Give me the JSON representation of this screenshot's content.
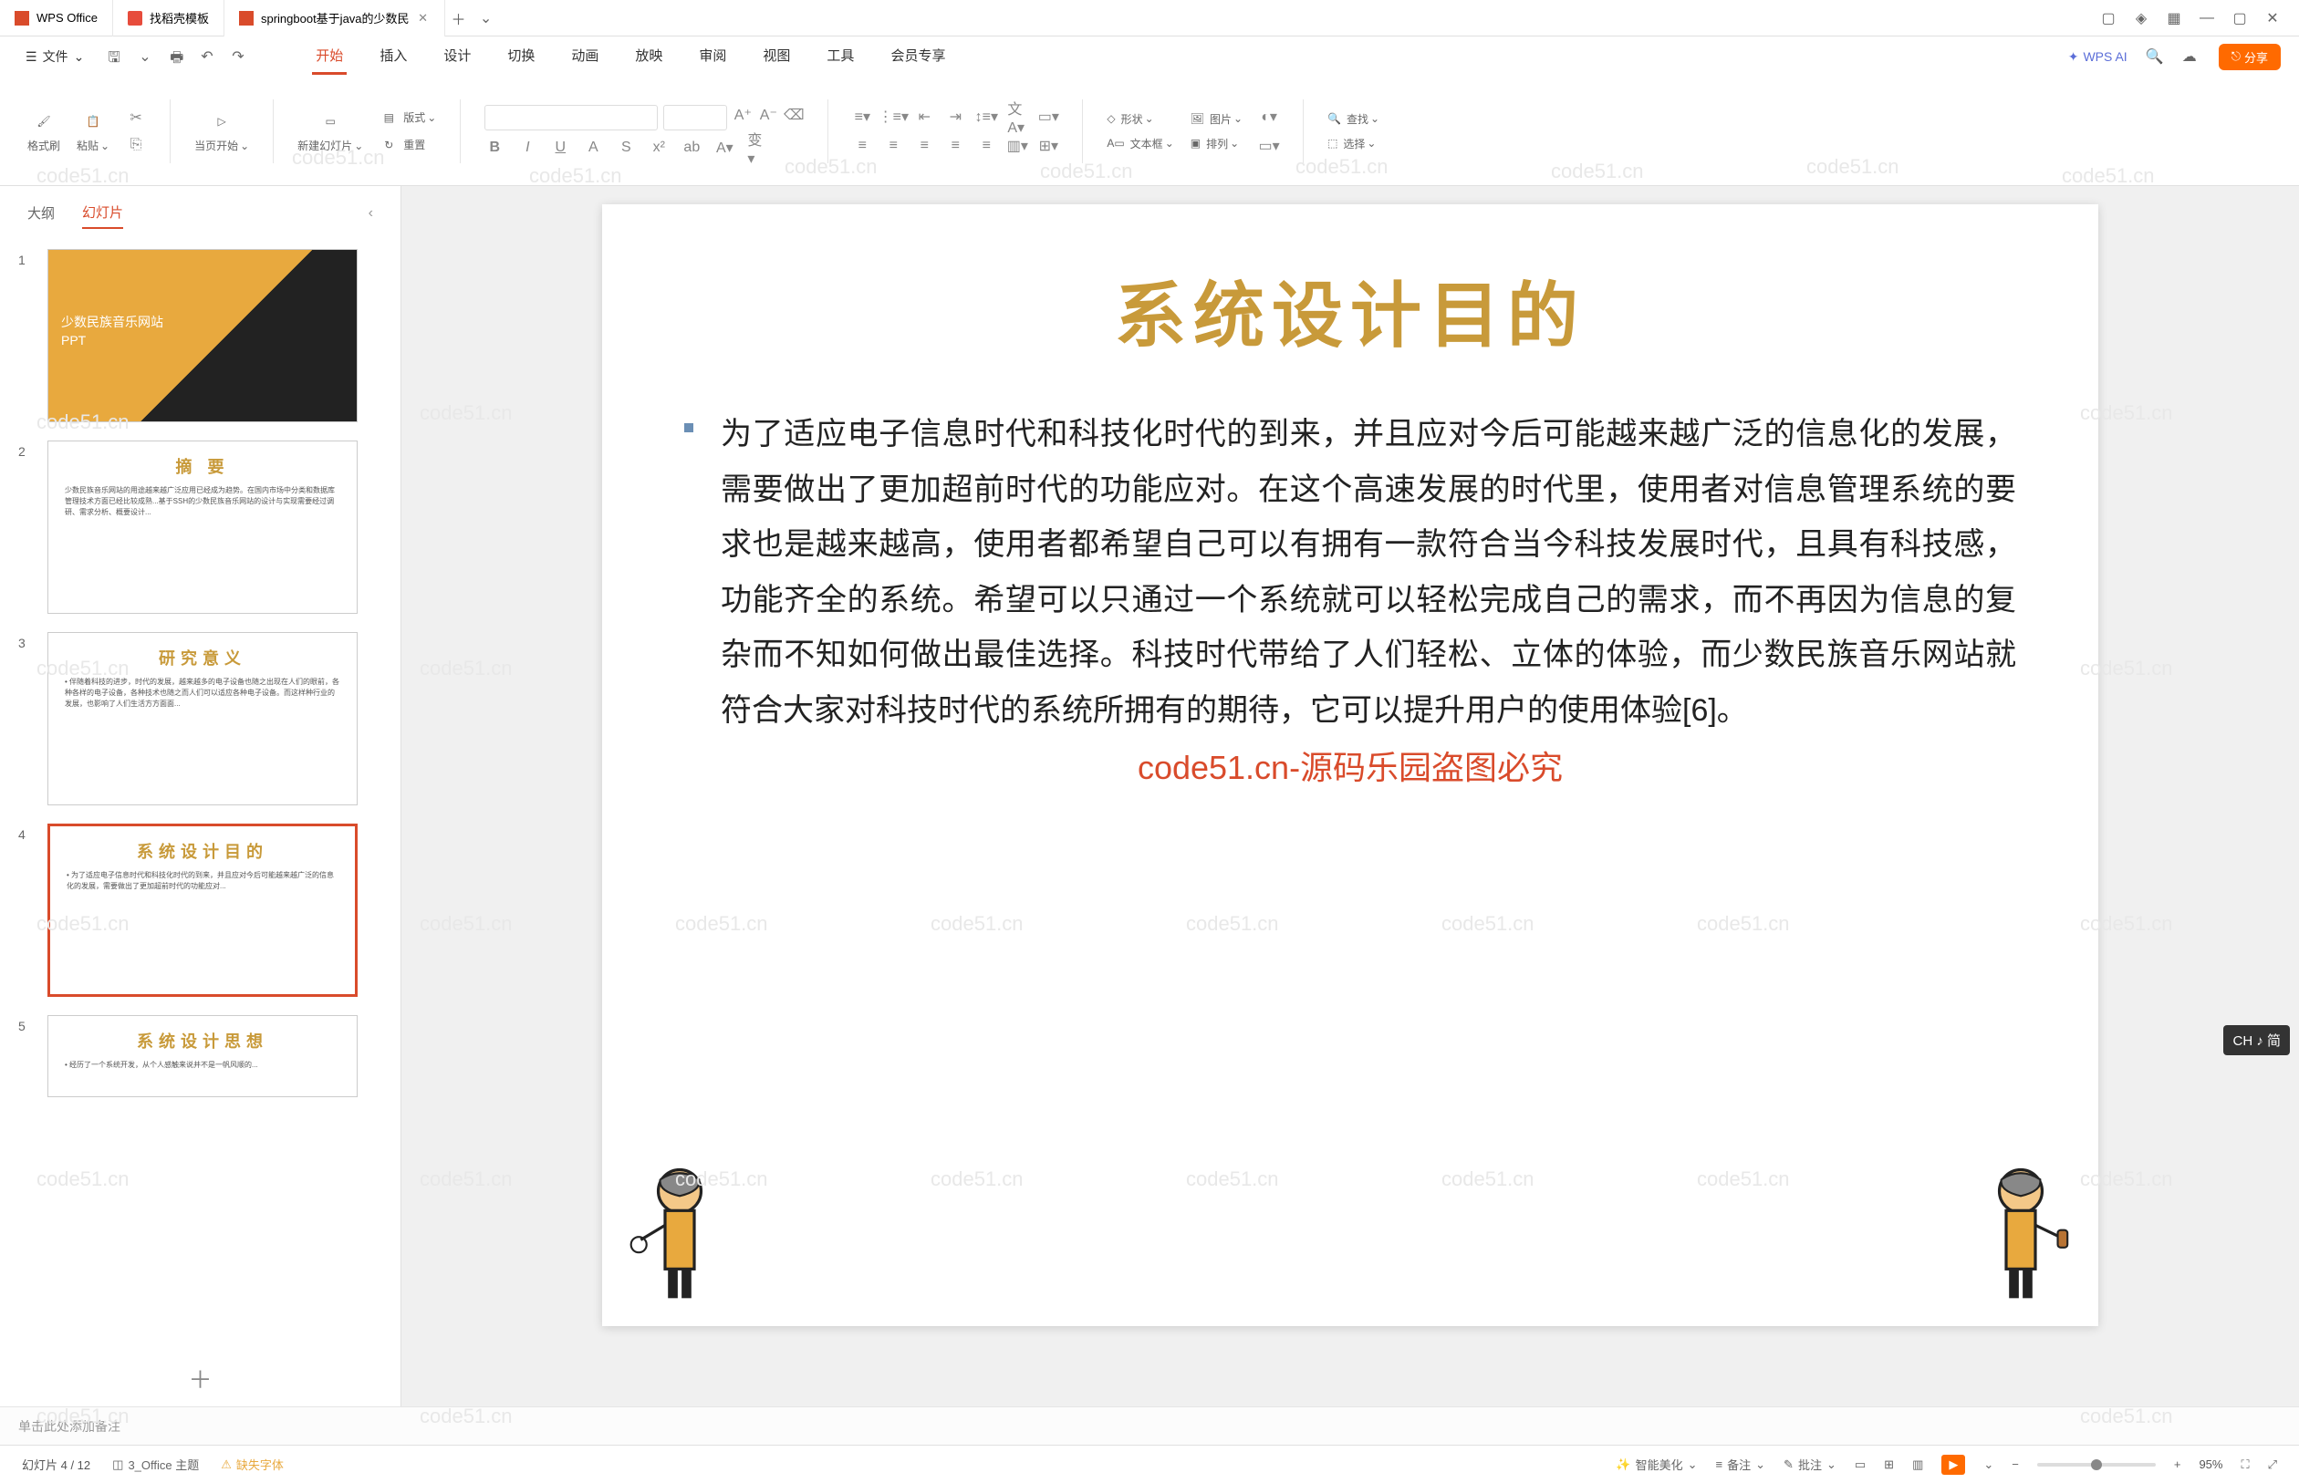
{
  "titlebar": {
    "tabs": [
      {
        "label": "WPS Office"
      },
      {
        "label": "找稻壳模板"
      },
      {
        "label": "springboot基于java的少数民"
      }
    ]
  },
  "menubar": {
    "file": "文件",
    "tabs": [
      "开始",
      "插入",
      "设计",
      "切换",
      "动画",
      "放映",
      "审阅",
      "视图",
      "工具",
      "会员专享"
    ],
    "wps_ai": "WPS AI",
    "share": "分享"
  },
  "ribbon": {
    "format_brush": "格式刷",
    "paste": "粘贴",
    "from_current": "当页开始",
    "new_slide": "新建幻灯片",
    "layout": "版式",
    "reset": "重置",
    "shape": "形状",
    "picture": "图片",
    "textbox": "文本框",
    "arrange": "排列",
    "find": "查找",
    "select": "选择"
  },
  "sidepanel": {
    "outline": "大纲",
    "slides": "幻灯片"
  },
  "thumbs": [
    {
      "num": "1",
      "title": "少数民族音乐网站\nPPT"
    },
    {
      "num": "2",
      "title": "摘  要"
    },
    {
      "num": "3",
      "title": "研究意义"
    },
    {
      "num": "4",
      "title": "系统设计目的"
    },
    {
      "num": "5",
      "title": "系统设计思想"
    }
  ],
  "slide": {
    "title": "系统设计目的",
    "body": "为了适应电子信息时代和科技化时代的到来，并且应对今后可能越来越广泛的信息化的发展，需要做出了更加超前时代的功能应对。在这个高速发展的时代里，使用者对信息管理系统的要求也是越来越高，使用者都希望自己可以有拥有一款符合当今科技发展时代，且具有科技感，功能齐全的系统。希望可以只通过一个系统就可以轻松完成自己的需求，而不再因为信息的复杂而不知如何做出最佳选择。科技时代带给了人们轻松、立体的体验，而少数民族音乐网站就符合大家对科技时代的系统所拥有的期待，它可以提升用户的使用体验[6]。"
  },
  "watermark_overlay": "code51.cn-源码乐园盗图必究",
  "wm": "code51.cn",
  "notes": {
    "placeholder": "单击此处添加备注"
  },
  "statusbar": {
    "slide_pos": "幻灯片 4 / 12",
    "theme": "3_Office 主题",
    "missing_font": "缺失字体",
    "beautify": "智能美化",
    "notes_btn": "备注",
    "comments": "批注",
    "zoom": "95%"
  },
  "ime": "CH ♪ 简"
}
